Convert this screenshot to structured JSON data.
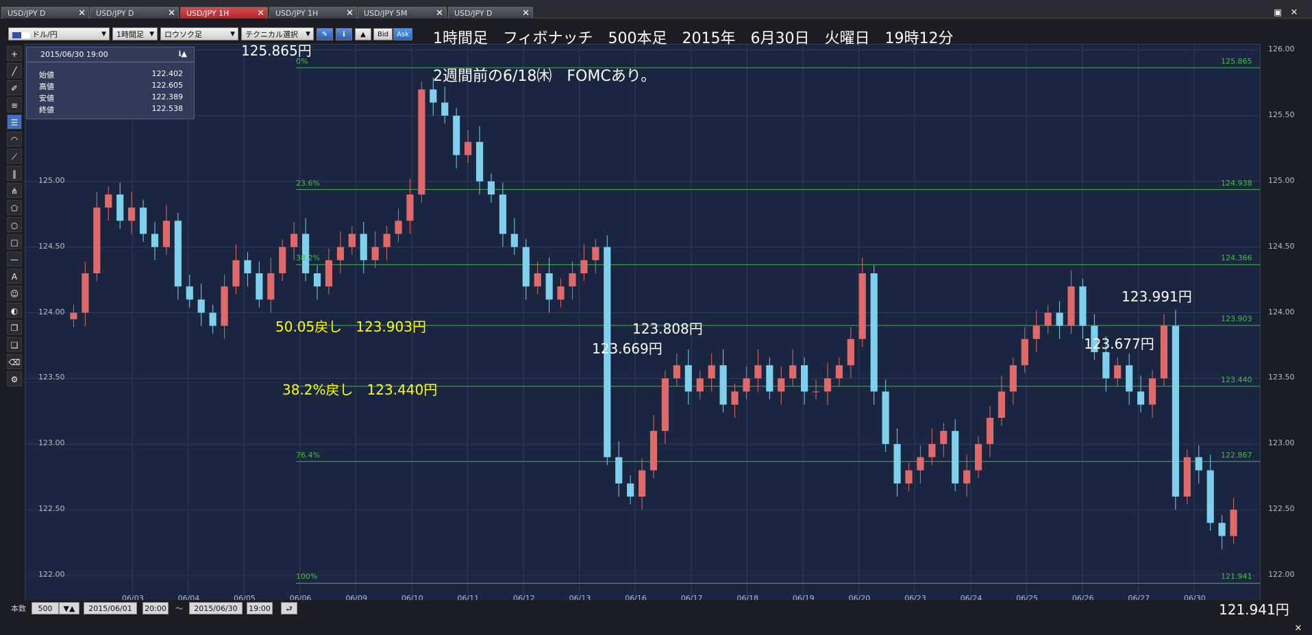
{
  "tabs": [
    {
      "label": "USD/JPY D",
      "active": false
    },
    {
      "label": "USD/JPY D",
      "active": false
    },
    {
      "label": "USD/JPY 1H",
      "active": true
    },
    {
      "label": "USD/JPY 1H",
      "active": false
    },
    {
      "label": "USD/JPY 5M",
      "active": false
    },
    {
      "label": "USD/JPY D",
      "active": false
    }
  ],
  "window_buttons": {
    "restore": "▣",
    "close": "✕"
  },
  "toolbar": {
    "symbol": "ドル/円",
    "timeframe": "1時間足",
    "chart_type": "ロウソク足",
    "technical": "テクニカル選択",
    "bid_label": "Bid",
    "ask_label": "Ask"
  },
  "info": {
    "datetime": "2015/06/30 19:00",
    "rows": [
      {
        "label": "始値",
        "value": "122.402"
      },
      {
        "label": "高値",
        "value": "122.605"
      },
      {
        "label": "安値",
        "value": "122.389"
      },
      {
        "label": "終値",
        "value": "122.538"
      }
    ]
  },
  "annotations": {
    "header_line1": "1時間足　フィボナッチ　500本足　2015年　6月30日　火曜日　19時12分",
    "header_line2": "2週間前の6/18㈭　FOMCあり。",
    "high_label": "125.865円",
    "low_label": "121.941円",
    "retrace_50": "50.05戻し　123.903円",
    "retrace_382": "38.2%戻し　123.440円",
    "p1": "123.669円",
    "p2": "123.808円",
    "p3": "123.991円",
    "p4": "123.677円"
  },
  "chart_data": {
    "type": "candlestick",
    "symbol": "USD/JPY",
    "ylim": [
      121.9,
      126.0
    ],
    "y_ticks": [
      "126.00",
      "125.50",
      "125.00",
      "124.50",
      "124.00",
      "123.50",
      "123.00",
      "122.50",
      "122.00"
    ],
    "x_ticks": [
      "06/03",
      "06/04",
      "06/05",
      "06/06",
      "06/09",
      "06/10",
      "06/11",
      "06/12",
      "06/13",
      "06/16",
      "06/17",
      "06/18",
      "06/19",
      "06/20",
      "06/23",
      "06/24",
      "06/25",
      "06/26",
      "06/27",
      "06/30"
    ],
    "fibonacci": [
      {
        "pct": "0%",
        "value": 125.865,
        "label": "125.865"
      },
      {
        "pct": "23.6%",
        "value": 124.938,
        "label": "124.938"
      },
      {
        "pct": "38.2%",
        "value": 124.366,
        "label": "124.366"
      },
      {
        "pct": "",
        "value": 123.903,
        "label": "123.903"
      },
      {
        "pct": "",
        "value": 123.44,
        "label": "123.440"
      },
      {
        "pct": "76.4%",
        "value": 122.867,
        "label": "122.867"
      },
      {
        "pct": "100%",
        "value": 121.941,
        "label": "121.941"
      }
    ],
    "closes": [
      124.0,
      124.3,
      124.8,
      124.9,
      124.7,
      124.8,
      124.6,
      124.5,
      124.7,
      124.2,
      124.1,
      124.0,
      123.9,
      124.2,
      124.4,
      124.3,
      124.1,
      124.3,
      124.5,
      124.6,
      124.3,
      124.2,
      124.4,
      124.5,
      124.6,
      124.4,
      124.5,
      124.6,
      124.7,
      124.9,
      125.7,
      125.6,
      125.5,
      125.2,
      125.3,
      125.0,
      124.9,
      124.6,
      124.5,
      124.2,
      124.3,
      124.1,
      124.2,
      124.3,
      124.4,
      124.5,
      122.9,
      122.7,
      122.6,
      122.8,
      123.1,
      123.5,
      123.6,
      123.4,
      123.5,
      123.6,
      123.3,
      123.4,
      123.5,
      123.6,
      123.4,
      123.5,
      123.6,
      123.4,
      123.4,
      123.5,
      123.6,
      123.8,
      124.3,
      123.4,
      123.0,
      122.7,
      122.8,
      122.9,
      123.0,
      123.1,
      122.7,
      122.8,
      123.0,
      123.2,
      123.4,
      123.6,
      123.8,
      123.9,
      124.0,
      123.9,
      124.2,
      123.9,
      123.7,
      123.5,
      123.6,
      123.4,
      123.3,
      123.5,
      123.9,
      122.6,
      122.9,
      122.8,
      122.4,
      122.3,
      122.5
    ]
  }
}
